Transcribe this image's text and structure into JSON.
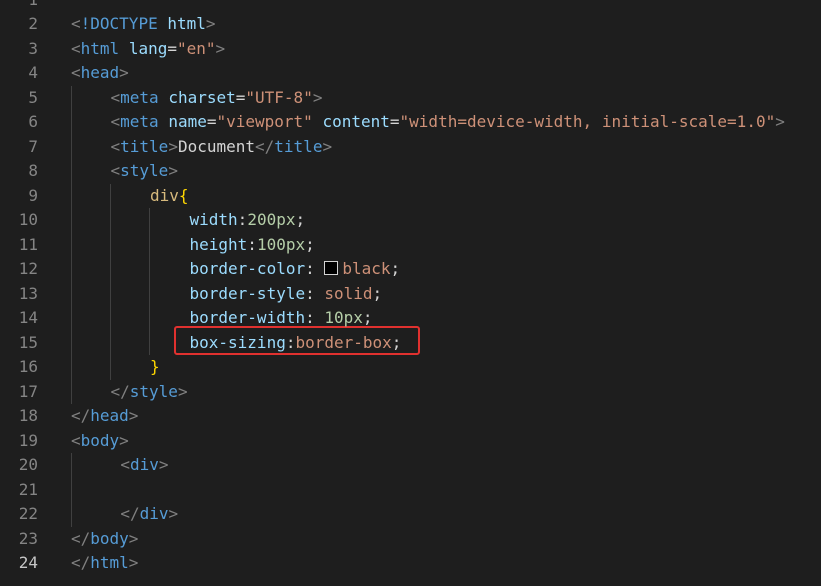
{
  "editor": {
    "lines": [
      {
        "n": "1",
        "parts": []
      },
      {
        "n": "2",
        "indent": 0,
        "parts": [
          [
            "punct",
            "<"
          ],
          [
            "tag",
            "!DOCTYPE"
          ],
          [
            "text",
            " "
          ],
          [
            "attr",
            "html"
          ],
          [
            "punct",
            ">"
          ]
        ]
      },
      {
        "n": "3",
        "indent": 0,
        "parts": [
          [
            "punct",
            "<"
          ],
          [
            "tag",
            "html"
          ],
          [
            "text",
            " "
          ],
          [
            "attr",
            "lang"
          ],
          [
            "text",
            "="
          ],
          [
            "str",
            "\"en\""
          ],
          [
            "punct",
            ">"
          ]
        ]
      },
      {
        "n": "4",
        "indent": 0,
        "parts": [
          [
            "punct",
            "<"
          ],
          [
            "tag",
            "head"
          ],
          [
            "punct",
            ">"
          ]
        ]
      },
      {
        "n": "5",
        "indent": 1,
        "parts": [
          [
            "punct",
            "<"
          ],
          [
            "tag",
            "meta"
          ],
          [
            "text",
            " "
          ],
          [
            "attr",
            "charset"
          ],
          [
            "text",
            "="
          ],
          [
            "str",
            "\"UTF-8\""
          ],
          [
            "punct",
            ">"
          ]
        ]
      },
      {
        "n": "6",
        "indent": 1,
        "parts": [
          [
            "punct",
            "<"
          ],
          [
            "tag",
            "meta"
          ],
          [
            "text",
            " "
          ],
          [
            "attr",
            "name"
          ],
          [
            "text",
            "="
          ],
          [
            "str",
            "\"viewport\""
          ],
          [
            "text",
            " "
          ],
          [
            "attr",
            "content"
          ],
          [
            "text",
            "="
          ],
          [
            "str",
            "\"width=device-width, initial-scale=1.0\""
          ],
          [
            "punct",
            ">"
          ]
        ]
      },
      {
        "n": "7",
        "indent": 1,
        "parts": [
          [
            "punct",
            "<"
          ],
          [
            "tag",
            "title"
          ],
          [
            "punct",
            ">"
          ],
          [
            "text",
            "Document"
          ],
          [
            "punct",
            "</"
          ],
          [
            "tag",
            "title"
          ],
          [
            "punct",
            ">"
          ]
        ]
      },
      {
        "n": "8",
        "indent": 1,
        "parts": [
          [
            "punct",
            "<"
          ],
          [
            "tag",
            "style"
          ],
          [
            "punct",
            ">"
          ]
        ]
      },
      {
        "n": "9",
        "indent": 2,
        "parts": [
          [
            "sel",
            "div"
          ],
          [
            "brace",
            "{"
          ]
        ]
      },
      {
        "n": "10",
        "indent": 3,
        "parts": [
          [
            "prop",
            "width"
          ],
          [
            "text",
            ":"
          ],
          [
            "num",
            "200px"
          ],
          [
            "text",
            ";"
          ]
        ]
      },
      {
        "n": "11",
        "indent": 3,
        "parts": [
          [
            "prop",
            "height"
          ],
          [
            "text",
            ":"
          ],
          [
            "num",
            "100px"
          ],
          [
            "text",
            ";"
          ]
        ]
      },
      {
        "n": "12",
        "indent": 3,
        "parts": [
          [
            "prop",
            "border-color"
          ],
          [
            "text",
            ": "
          ],
          [
            "swatch",
            ""
          ],
          [
            "val",
            "black"
          ],
          [
            "text",
            ";"
          ]
        ]
      },
      {
        "n": "13",
        "indent": 3,
        "parts": [
          [
            "prop",
            "border-style"
          ],
          [
            "text",
            ": "
          ],
          [
            "val",
            "solid"
          ],
          [
            "text",
            ";"
          ]
        ]
      },
      {
        "n": "14",
        "indent": 3,
        "parts": [
          [
            "prop",
            "border-width"
          ],
          [
            "text",
            ": "
          ],
          [
            "num",
            "10px"
          ],
          [
            "text",
            ";"
          ]
        ]
      },
      {
        "n": "15",
        "indent": 3,
        "parts": [
          [
            "prop",
            "box-sizing"
          ],
          [
            "text",
            ":"
          ],
          [
            "val",
            "border-box"
          ],
          [
            "text",
            ";"
          ]
        ]
      },
      {
        "n": "16",
        "indent": 2,
        "parts": [
          [
            "brace",
            "}"
          ]
        ]
      },
      {
        "n": "17",
        "indent": 1,
        "parts": [
          [
            "punct",
            "</"
          ],
          [
            "tag",
            "style"
          ],
          [
            "punct",
            ">"
          ]
        ]
      },
      {
        "n": "18",
        "indent": 0,
        "parts": [
          [
            "punct",
            "</"
          ],
          [
            "tag",
            "head"
          ],
          [
            "punct",
            ">"
          ]
        ]
      },
      {
        "n": "19",
        "indent": 0,
        "parts": [
          [
            "punct",
            "<"
          ],
          [
            "tag",
            "body"
          ],
          [
            "punct",
            ">"
          ]
        ]
      },
      {
        "n": "20",
        "indent": 1.25,
        "parts": [
          [
            "punct",
            "<"
          ],
          [
            "tag",
            "div"
          ],
          [
            "punct",
            ">"
          ]
        ]
      },
      {
        "n": "21",
        "indent": 0,
        "parts": []
      },
      {
        "n": "22",
        "indent": 1.25,
        "parts": [
          [
            "punct",
            "</"
          ],
          [
            "tag",
            "div"
          ],
          [
            "punct",
            ">"
          ]
        ]
      },
      {
        "n": "23",
        "indent": 0,
        "parts": [
          [
            "punct",
            "</"
          ],
          [
            "tag",
            "body"
          ],
          [
            "punct",
            ">"
          ]
        ]
      },
      {
        "n": "24",
        "indent": 0,
        "current": true,
        "parts": [
          [
            "punct",
            "</"
          ],
          [
            "tag",
            "html"
          ],
          [
            "punct",
            ">"
          ]
        ]
      }
    ]
  },
  "colors": {
    "background": "#1e1e1e",
    "highlight_border": "#e0312f"
  }
}
